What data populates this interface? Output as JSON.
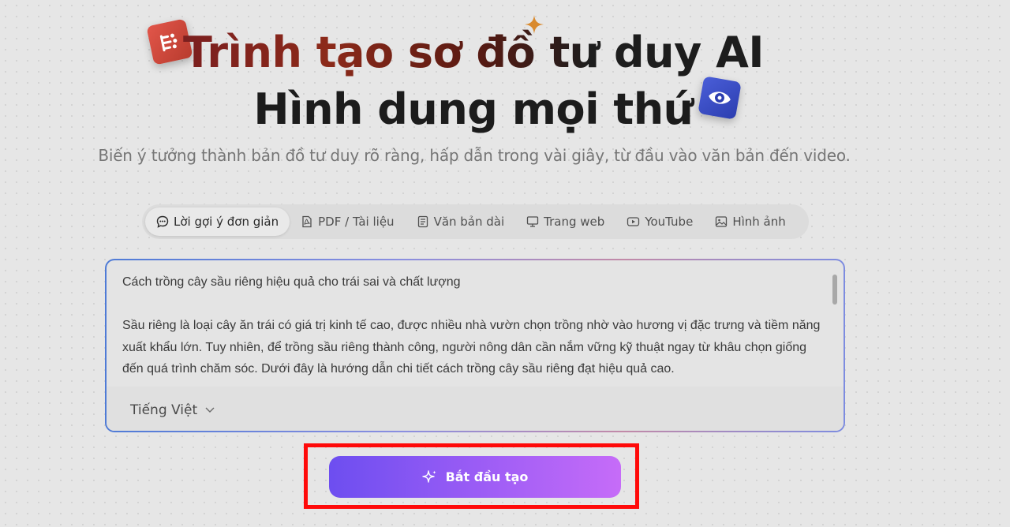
{
  "hero": {
    "title_line1": "Trình tạo sơ đồ tư duy AI",
    "title_line2": "Hình dung mọi thứ",
    "subtitle": "Biến ý tưởng thành bản đồ tư duy rõ ràng, hấp dẫn trong vài giây, từ đầu vào văn bản đến video."
  },
  "tabs": [
    {
      "label": "Lời gợi ý đơn giản",
      "icon": "chat-icon",
      "active": true
    },
    {
      "label": "PDF / Tài liệu",
      "icon": "pdf-icon",
      "active": false
    },
    {
      "label": "Văn bản dài",
      "icon": "document-icon",
      "active": false
    },
    {
      "label": "Trang web",
      "icon": "monitor-icon",
      "active": false
    },
    {
      "label": "YouTube",
      "icon": "youtube-icon",
      "active": false
    },
    {
      "label": "Hình ảnh",
      "icon": "image-icon",
      "active": false
    }
  ],
  "editor": {
    "heading": "Cách trồng cây sầu riêng hiệu quả cho trái sai và chất lượng",
    "body": "Sầu riêng là loại cây ăn trái có giá trị kinh tế cao, được nhiều nhà vườn chọn trồng nhờ vào hương vị đặc trưng và tiềm năng xuất khẩu lớn. Tuy nhiên, để trồng sầu riêng thành công, người nông dân cần nắm vững kỹ thuật ngay từ khâu chọn giống đến quá trình chăm sóc. Dưới đây là hướng dẫn chi tiết cách trồng cây sầu riêng đạt hiệu quả cao."
  },
  "language": {
    "selected": "Tiếng Việt"
  },
  "start_button": {
    "label": "Bắt đầu tạo"
  },
  "colors": {
    "button_gradient_start": "#6d4ef0",
    "button_gradient_end": "#c66cf8",
    "highlight_border": "#ff0a0a"
  }
}
